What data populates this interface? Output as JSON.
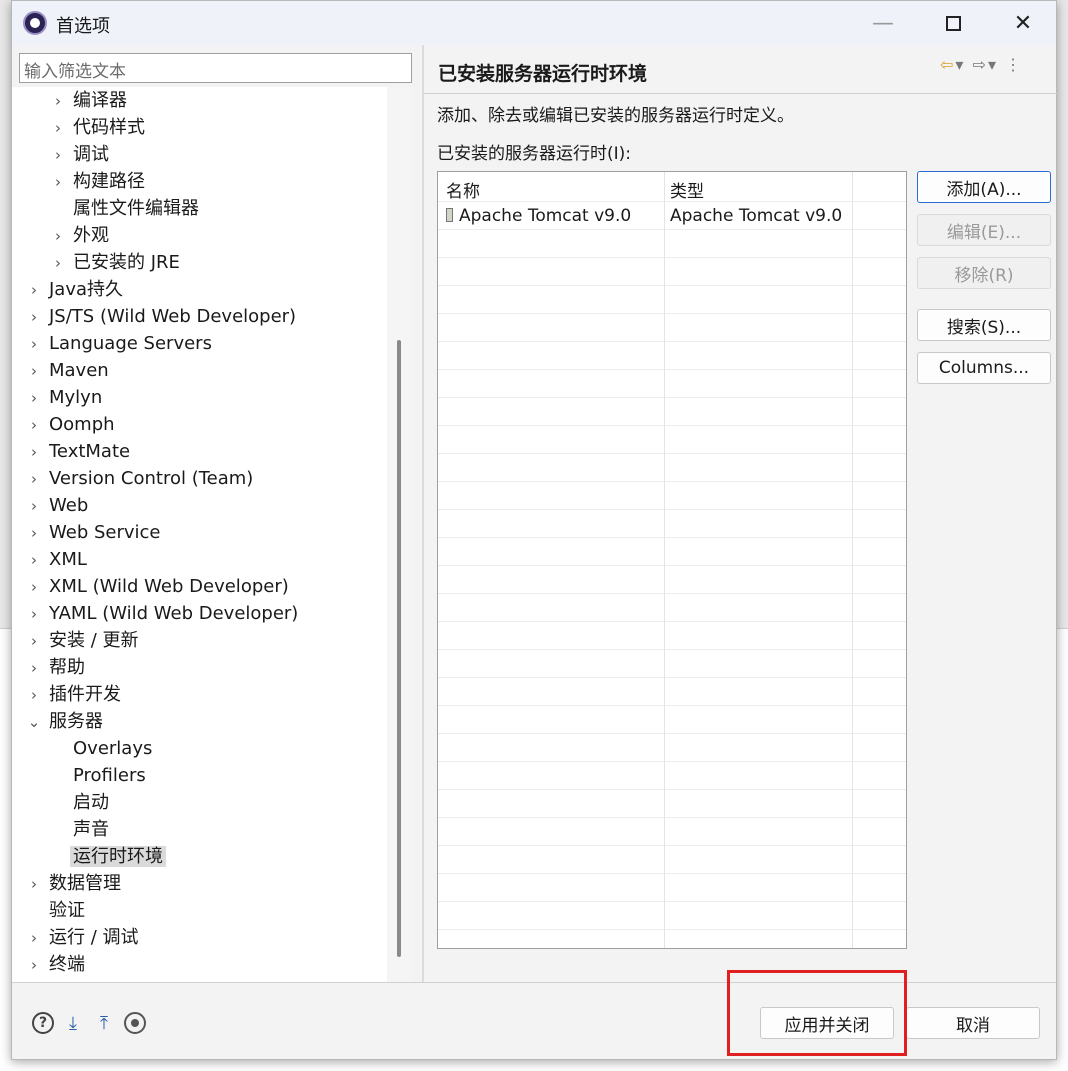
{
  "window": {
    "title": "首选项"
  },
  "filter": {
    "placeholder": "输入筛选文本"
  },
  "tree": [
    {
      "label": "编译器",
      "level": 1,
      "expand": "collapsed"
    },
    {
      "label": "代码样式",
      "level": 1,
      "expand": "collapsed"
    },
    {
      "label": "调试",
      "level": 1,
      "expand": "collapsed"
    },
    {
      "label": "构建路径",
      "level": 1,
      "expand": "collapsed"
    },
    {
      "label": "属性文件编辑器",
      "level": 1,
      "expand": "none"
    },
    {
      "label": "外观",
      "level": 1,
      "expand": "collapsed"
    },
    {
      "label": "已安装的 JRE",
      "level": 1,
      "expand": "collapsed"
    },
    {
      "label": "Java持久",
      "level": 0,
      "expand": "collapsed"
    },
    {
      "label": "JS/TS (Wild Web Developer)",
      "level": 0,
      "expand": "collapsed"
    },
    {
      "label": "Language Servers",
      "level": 0,
      "expand": "collapsed"
    },
    {
      "label": "Maven",
      "level": 0,
      "expand": "collapsed"
    },
    {
      "label": "Mylyn",
      "level": 0,
      "expand": "collapsed"
    },
    {
      "label": "Oomph",
      "level": 0,
      "expand": "collapsed"
    },
    {
      "label": "TextMate",
      "level": 0,
      "expand": "collapsed"
    },
    {
      "label": "Version Control (Team)",
      "level": 0,
      "expand": "collapsed"
    },
    {
      "label": "Web",
      "level": 0,
      "expand": "collapsed"
    },
    {
      "label": "Web Service",
      "level": 0,
      "expand": "collapsed"
    },
    {
      "label": "XML",
      "level": 0,
      "expand": "collapsed"
    },
    {
      "label": "XML (Wild Web Developer)",
      "level": 0,
      "expand": "collapsed"
    },
    {
      "label": "YAML (Wild Web Developer)",
      "level": 0,
      "expand": "collapsed"
    },
    {
      "label": "安装 / 更新",
      "level": 0,
      "expand": "collapsed"
    },
    {
      "label": "帮助",
      "level": 0,
      "expand": "collapsed"
    },
    {
      "label": "插件开发",
      "level": 0,
      "expand": "collapsed"
    },
    {
      "label": "服务器",
      "level": 0,
      "expand": "expanded"
    },
    {
      "label": "Overlays",
      "level": 1,
      "expand": "none"
    },
    {
      "label": "Profilers",
      "level": 1,
      "expand": "none"
    },
    {
      "label": "启动",
      "level": 1,
      "expand": "none"
    },
    {
      "label": "声音",
      "level": 1,
      "expand": "none"
    },
    {
      "label": "运行时环境",
      "level": 1,
      "expand": "none",
      "selected": true
    },
    {
      "label": "数据管理",
      "level": 0,
      "expand": "collapsed"
    },
    {
      "label": "验证",
      "level": 0,
      "expand": "none"
    },
    {
      "label": "运行 / 调试",
      "level": 0,
      "expand": "collapsed"
    },
    {
      "label": "终端",
      "level": 0,
      "expand": "collapsed"
    }
  ],
  "page": {
    "title": "已安装服务器运行时环境",
    "description": "添加、除去或编辑已安装的服务器运行时定义。",
    "list_label": "已安装的服务器运行时(I):",
    "columns": [
      "名称",
      "类型"
    ],
    "rows": [
      {
        "name": "Apache Tomcat v9.0",
        "type": "Apache Tomcat v9.0"
      }
    ]
  },
  "buttons": {
    "add": "添加(A)...",
    "edit": "编辑(E)...",
    "remove": "移除(R)",
    "search": "搜索(S)...",
    "columns": "Columns...",
    "apply_close": "应用并关闭",
    "cancel": "取消"
  },
  "icons": {
    "app": "eclipse-icon",
    "nav_back": "back-arrow-icon",
    "nav_forward": "forward-arrow-icon",
    "help": "help-icon",
    "import": "import-icon",
    "export": "export-icon",
    "record": "record-icon"
  },
  "colors": {
    "highlight": "#e02020",
    "primary_border": "#2a6cd0"
  }
}
